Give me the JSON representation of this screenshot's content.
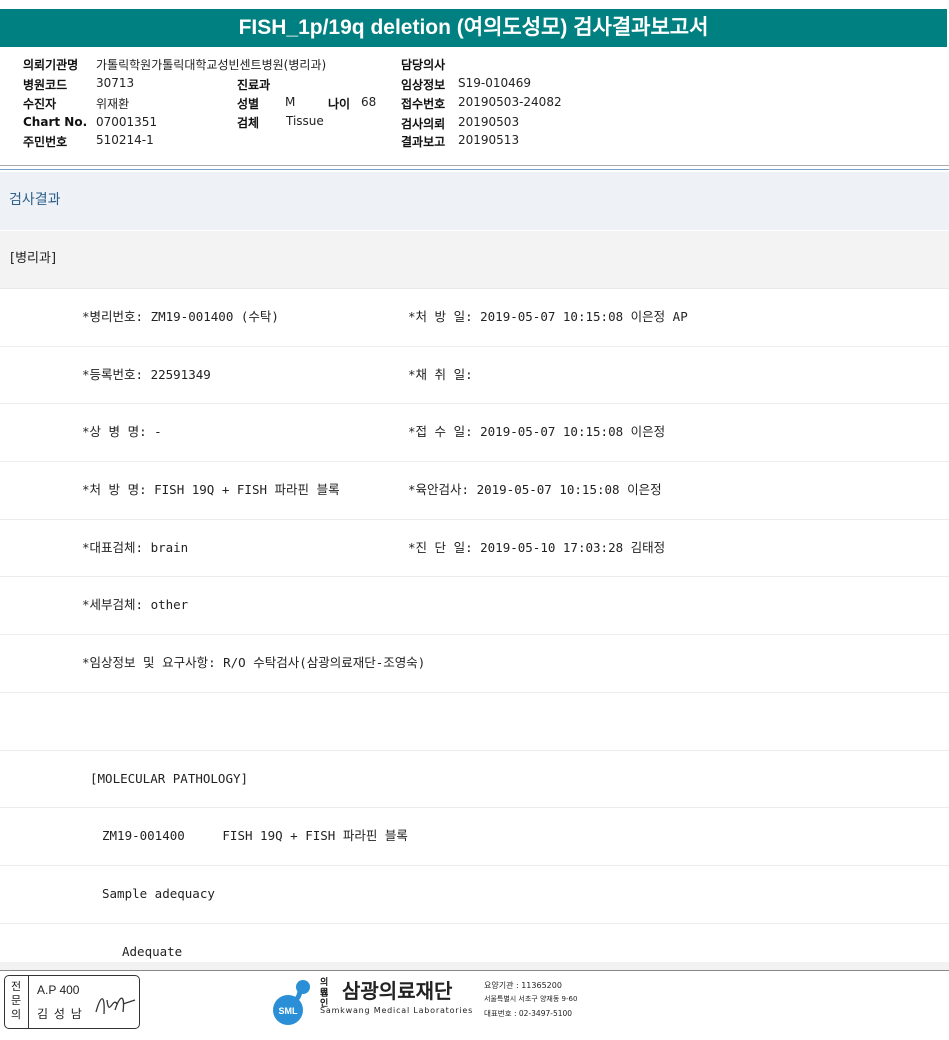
{
  "title": "FISH_1p/19q deletion (여의도성모) 검사결과보고서",
  "header": {
    "institution_label": "의뢰기관명",
    "institution_value": "가톨릭학원가톨릭대학교성빈센트병원(병리과)",
    "hospital_code_label": "병원코드",
    "hospital_code_value": "30713",
    "dept_label": "진료과",
    "doctor_label": "담당의사",
    "recipient_label": "수진자",
    "recipient_value": "위재환",
    "sex_label": "성별",
    "sex_value": "M",
    "age_label": "나이",
    "age_value": "68",
    "clinical_label": "임상정보",
    "clinical_value": "S19-010469",
    "receipt_label": "접수번호",
    "receipt_value": "20190503-24082",
    "chart_label": "Chart No.",
    "chart_value": "07001351",
    "specimen_label": "검체",
    "specimen_value": "Tissue",
    "request_label": "검사의뢰",
    "request_value": "20190503",
    "idnum_label": "주민번호",
    "idnum_value": "510214-1",
    "report_label": "결과보고",
    "report_value": "20190513"
  },
  "section_title": "검사결과",
  "department": "[병리과]",
  "rows": [
    {
      "left": "*병리번호: ZM19-001400 (수탁)",
      "right": "*처 방 일: 2019-05-07 10:15:08  이은정 AP"
    },
    {
      "left": "*등록번호: 22591349",
      "right": "*채 취 일:"
    },
    {
      "left": "*상 병 명: -",
      "right": "*접 수 일: 2019-05-07 10:15:08  이은정"
    },
    {
      "left": "*처 방 명: FISH 19Q + FISH 파라핀 블록",
      "right": "*육안검사: 2019-05-07 10:15:08  이은정"
    },
    {
      "left": "*대표검체: brain",
      "right": "*진 단 일: 2019-05-10 17:03:28  김태정"
    },
    {
      "left": "*세부검체: other",
      "right": ""
    },
    {
      "left": "*임상정보 및 요구사항: R/O 수탁검사(삼광의료재단-조영숙)",
      "right": ""
    },
    {
      "left": "",
      "right": ""
    },
    {
      "left": "[MOLECULAR PATHOLOGY]",
      "right": ""
    },
    {
      "left": "ZM19-001400     FISH 19Q + FISH 파라핀 블록",
      "right": ""
    },
    {
      "left": "Sample adequacy",
      "right": ""
    },
    {
      "left": "Adequate",
      "right": ""
    }
  ],
  "stamp": {
    "vertical_label": "전문의",
    "line1": "A.P 400",
    "line2": "김 성 남"
  },
  "logo": {
    "small_top": "의료",
    "small_bottom": "법인",
    "name": "삼광의료재단",
    "english": "Samkwang Medical Laboratories",
    "badge": "SML",
    "info1": "요양기관 : 11365200",
    "info2": "서울특별시 서초구 양재동 9-60",
    "info3": "대표번호 : 02-3497-5100"
  }
}
